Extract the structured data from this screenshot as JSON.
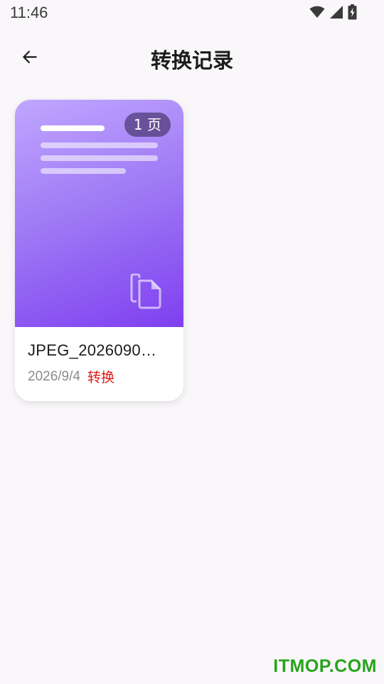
{
  "status_bar": {
    "time": "11:46",
    "icons": [
      "wifi-icon",
      "signal-icon",
      "battery-charging-icon"
    ]
  },
  "app_bar": {
    "back_icon": "arrow-left-icon",
    "title": "转换记录"
  },
  "records": [
    {
      "page_badge": "1 页",
      "file_name": "JPEG_2026090…",
      "date": "2026/9/4",
      "action_label": "转换",
      "thumb_icon": "copy-file-icon"
    }
  ],
  "watermark": "ITMOP.COM",
  "colors": {
    "background": "#f9f7f9",
    "thumb_gradient_start": "#c0a6ff",
    "thumb_gradient_end": "#7f3ff0",
    "action_red": "#e01818",
    "watermark_green": "#27a31d"
  }
}
